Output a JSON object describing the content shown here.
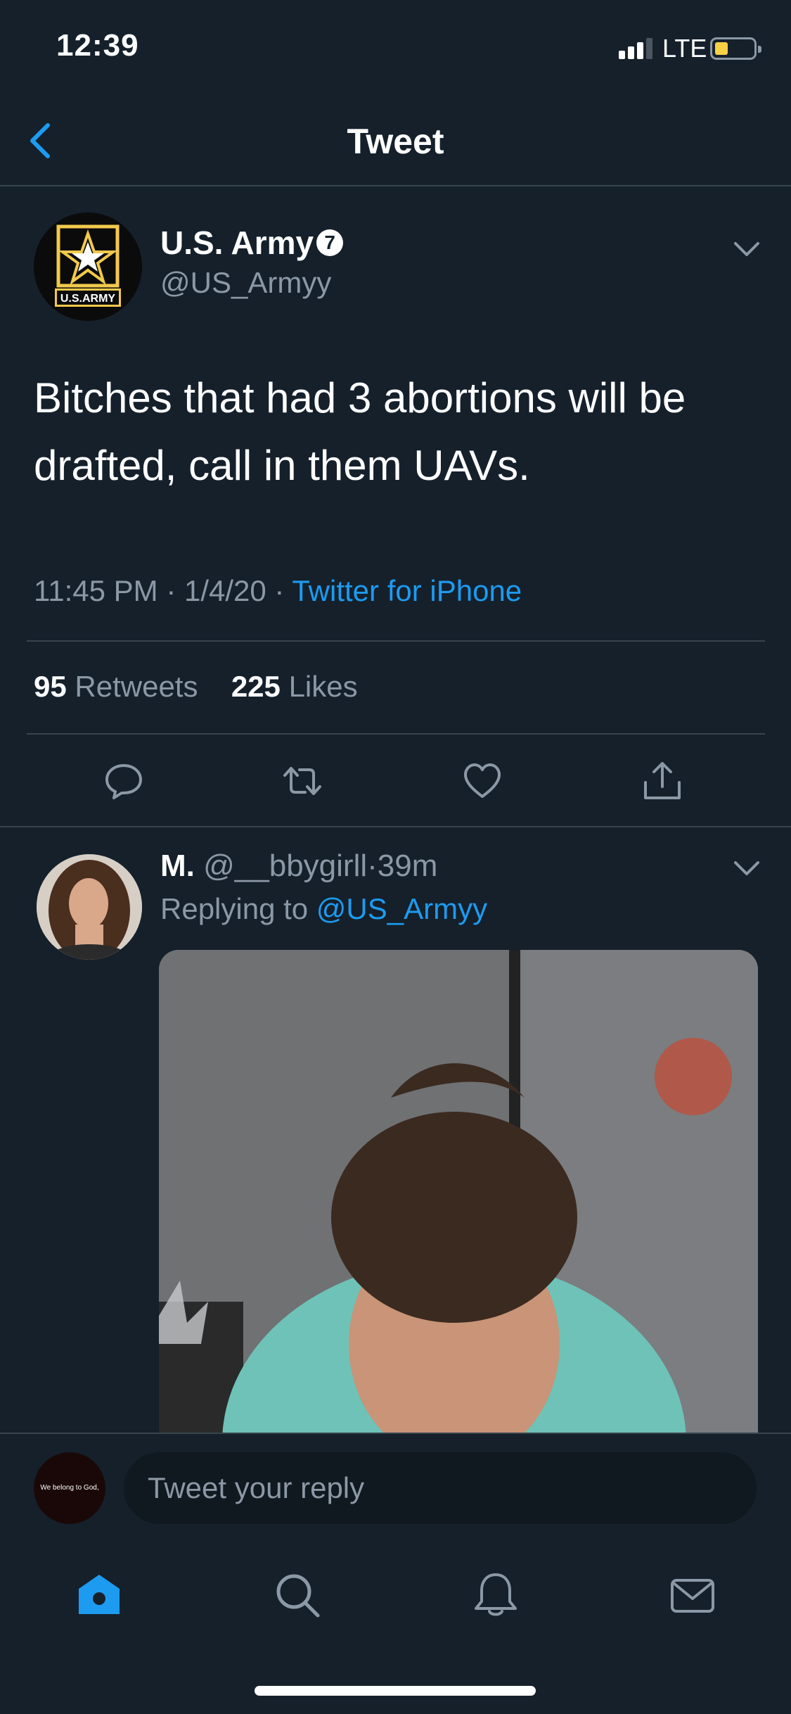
{
  "status_bar": {
    "time": "12:39",
    "network": "LTE",
    "signal_bars": 3,
    "battery_level": 0.3,
    "battery_color": "#f7d046"
  },
  "header": {
    "title": "Tweet",
    "back_icon": "chevron-left-icon"
  },
  "main_tweet": {
    "author_name": "U.S. Army",
    "verified_badge": "7",
    "handle": "@US_Armyy",
    "avatar_text": "U.S.ARMY",
    "text": "Bitches that had 3 abortions will be drafted, call in them UAVs.",
    "time": "11:45 PM",
    "date": "1/4/20",
    "source": "Twitter for iPhone",
    "retweets_count": "95",
    "retweets_label": "Retweets",
    "likes_count": "225",
    "likes_label": "Likes"
  },
  "actions": [
    "reply-icon",
    "retweet-icon",
    "like-icon",
    "share-icon"
  ],
  "reply": {
    "author_name": "M.",
    "handle": "@__bbygirll",
    "age": "39m",
    "replying_prefix": "Replying to",
    "replying_to": "@US_Armyy"
  },
  "compose": {
    "avatar_text": "We belong to God,",
    "placeholder": "Tweet your reply"
  },
  "tabbar": [
    "home-icon",
    "search-icon",
    "notifications-icon",
    "messages-icon"
  ],
  "colors": {
    "background": "#15202b",
    "accent": "#1d9bf0",
    "secondary_text": "#8b98a5",
    "divider": "#38444d"
  }
}
